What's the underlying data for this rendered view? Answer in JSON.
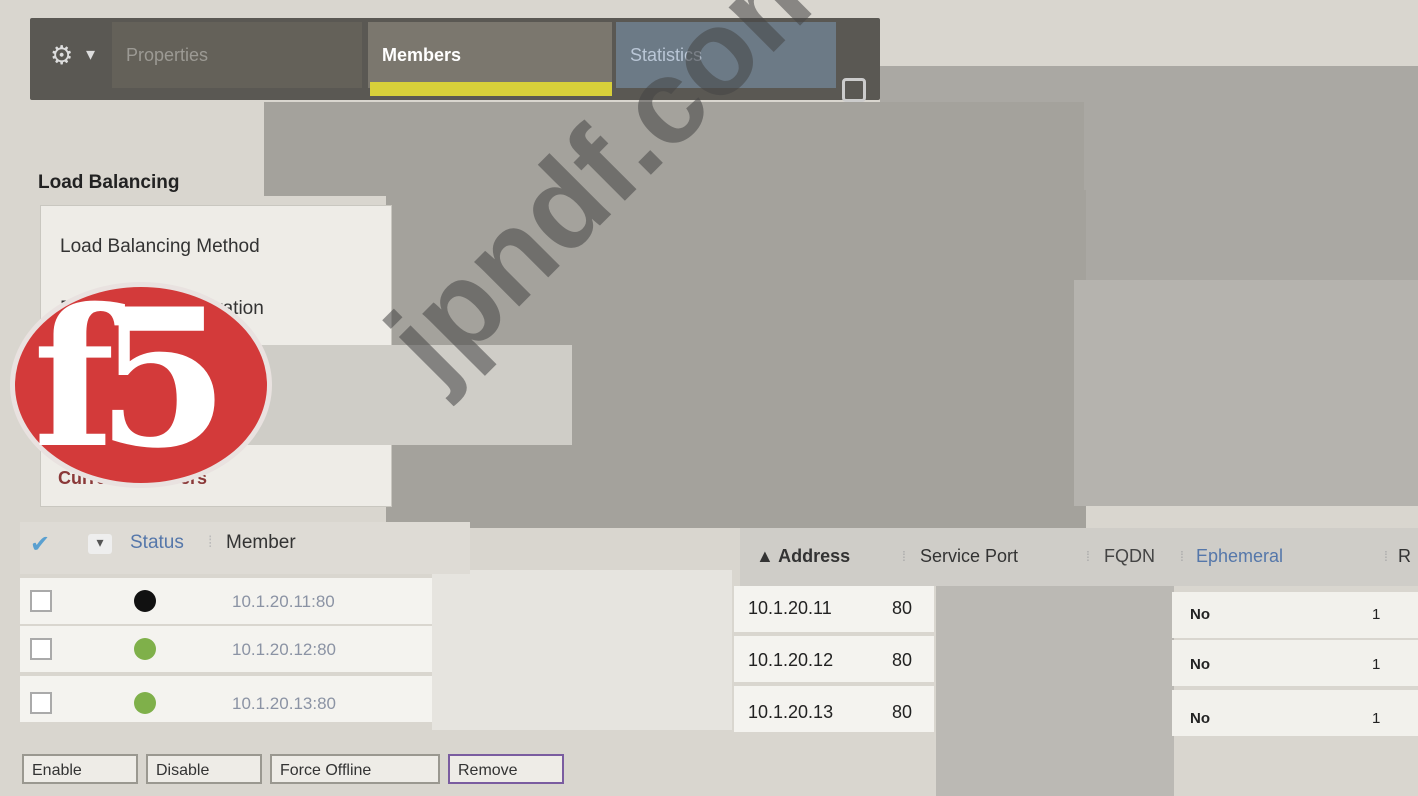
{
  "tabs": {
    "properties": "Properties",
    "members": "Members",
    "statistics": "Statistics",
    "settings_icon": "gear-icon",
    "caret_icon": "chevron-down-icon"
  },
  "load_balancing": {
    "heading": "Load Balancing",
    "method_label": "Load Balancing Method",
    "activation_label": "Priority Group Activation"
  },
  "current_members_heading": "Current Members",
  "table": {
    "headers": {
      "status": "Status",
      "member": "Member",
      "address": "▲ Address",
      "service_port": "Service Port",
      "fqdn": "FQDN",
      "ephemeral": "Ephemeral",
      "r": "R"
    },
    "rows": [
      {
        "status": "black",
        "member": "10.1.20.11:80",
        "address": "10.1.20.11",
        "port": "80",
        "ephemeral": "No",
        "r": "1"
      },
      {
        "status": "green",
        "member": "10.1.20.12:80",
        "address": "10.1.20.12",
        "port": "80",
        "ephemeral": "No",
        "r": "1"
      },
      {
        "status": "green",
        "member": "10.1.20.13:80",
        "address": "10.1.20.13",
        "port": "80",
        "ephemeral": "No",
        "r": "1"
      }
    ]
  },
  "buttons": {
    "enable": "Enable",
    "disable": "Disable",
    "force_offline": "Force Offline",
    "remove": "Remove"
  },
  "logo_text": "f5",
  "watermark": "jpndf.com",
  "colors": {
    "status_black": "#111111",
    "status_green": "#7fb04a",
    "logo_red": "#d33a3a"
  }
}
